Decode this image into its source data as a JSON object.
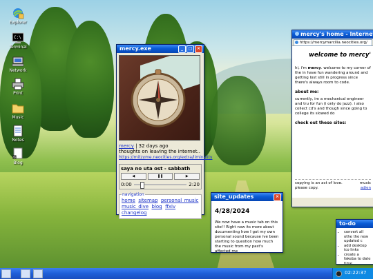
{
  "desktop_icons": [
    {
      "label": "Explorer",
      "icon": "ie-globe-icon"
    },
    {
      "label": "Terminal",
      "icon": "terminal-icon"
    },
    {
      "label": "Network",
      "icon": "network-icon"
    },
    {
      "label": "Print",
      "icon": "printer-icon"
    },
    {
      "label": "Music",
      "icon": "folder-icon"
    },
    {
      "label": "Notes",
      "icon": "notepad-icon"
    },
    {
      "label": "Blog",
      "icon": "page-icon"
    }
  ],
  "mercy_window": {
    "title": "mercy.exe",
    "post_user": "mercy",
    "post_time": "| 32 days ago",
    "post_text": "thoughts on leaving the internet..",
    "post_link": "https://mitzyme.neocities.org/extra/liminality",
    "track": "saya no uta ost - sabbath",
    "time_current": "0:00",
    "time_total": "2:20",
    "progress": 0.12,
    "nav_legend": "navigation",
    "nav_links": [
      "home",
      "sitemap",
      "personal_music",
      "music_dive",
      "blog",
      "ffxiv",
      "changelog"
    ]
  },
  "updates_window": {
    "title": "site_updates",
    "date": "4/28/2024",
    "text": "We now have a music tab on this site!! Right now its more about documenting how I got my own personal sound because ive been starting to question how much the music from my past's affected me"
  },
  "browser": {
    "title": "mercy's home - Internet Ex",
    "address": "https://mercymarcilia.neocities.org/",
    "heading": "welcome to mercy'",
    "intro_pre": "hi, i'm ",
    "intro_name": "mercy",
    "intro_rest": ". welcome to my corner of the in have fun wandering around and getting lost still in progress since there's always room to code.",
    "about_heading": "about me:",
    "about_text": "currently, im a mechanical engineer and tru for fun (i only do jazz). i also collect cd's and though since going to college its slowed do",
    "sites_heading": "check out these sites:",
    "footer_text": "copying is an act of love. please copy.",
    "footer_link": "please copy.",
    "footer_right1": "music",
    "footer_right2": "adien"
  },
  "todo_window": {
    "title": "to-do",
    "items": [
      "convert all othe the new updated c",
      "add desktop ico links",
      "create a fakeba to date time"
    ]
  },
  "taskbar": {
    "clock": "02:22:37"
  }
}
